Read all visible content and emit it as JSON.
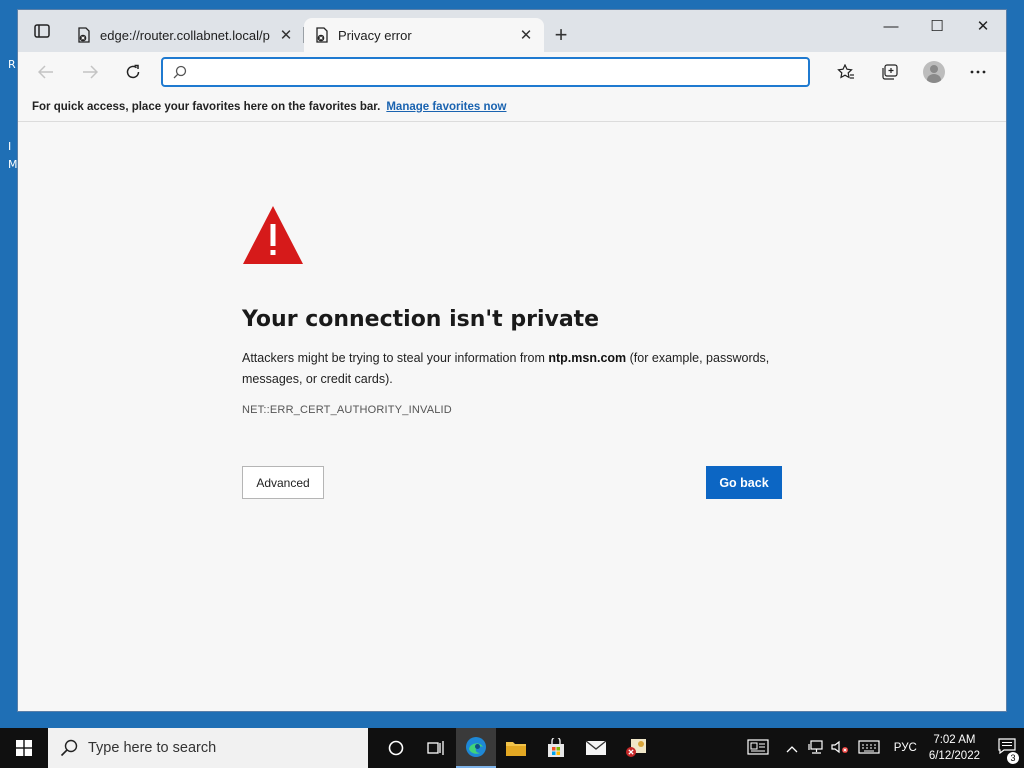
{
  "desktop": {
    "glyphs": [
      "R",
      "I",
      "M"
    ]
  },
  "tabs": [
    {
      "title": "edge://router.collabnet.local/pe",
      "close": "✕",
      "state": "inactive"
    },
    {
      "title": "Privacy error",
      "close": "✕",
      "state": "active"
    }
  ],
  "newtab_label": "+",
  "window_controls": {
    "minimize": "—",
    "maximize": "☐",
    "close": "✕"
  },
  "address": {
    "value": "",
    "placeholder": ""
  },
  "favorites_bar": {
    "text": "For quick access, place your favorites here on the favorites bar.",
    "link": "Manage favorites now"
  },
  "error": {
    "title": "Your connection isn't private",
    "desc_prefix": "Attackers might be trying to steal your information from ",
    "host": "ntp.msn.com",
    "desc_suffix": " (for example, passwords, messages, or credit cards).",
    "code": "NET::ERR_CERT_AUTHORITY_INVALID",
    "advanced_label": "Advanced",
    "goback_label": "Go back",
    "icon_color": "#d61a1a"
  },
  "taskbar": {
    "search_placeholder": "Type here to search",
    "language": "РУС",
    "time": "7:02 AM",
    "date": "6/12/2022",
    "notifications": "3"
  },
  "colors": {
    "accent": "#0c66c4",
    "taskbar": "#101010",
    "desktop": "#1f6fb5"
  }
}
